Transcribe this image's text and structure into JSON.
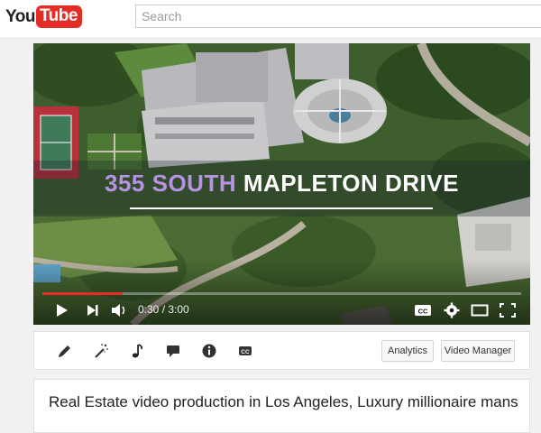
{
  "logo": {
    "you": "You",
    "tube": "Tube"
  },
  "search": {
    "placeholder": "Search"
  },
  "video": {
    "overlay_title_part1": "355 SOUTH",
    "overlay_title_part2": "MAPLETON DRIVE",
    "time_display": "0:30 / 3:00",
    "progress_fraction": 0.167,
    "progress_color": "#e52d27"
  },
  "controls": {
    "play": "play-icon",
    "next": "next-icon",
    "volume": "volume-icon",
    "captions": "cc-icon",
    "settings": "gear-icon",
    "theater": "theater-icon",
    "fullscreen": "fullscreen-icon"
  },
  "toolbar": {
    "tools": [
      "pencil-icon",
      "magic-wand-icon",
      "music-note-icon",
      "speech-bubble-icon",
      "info-icon",
      "cc-icon"
    ],
    "analytics_label": "Analytics",
    "video_manager_label": "Video Manager"
  },
  "title": "Real Estate video production in Los Angeles, Luxury millionaire mans"
}
